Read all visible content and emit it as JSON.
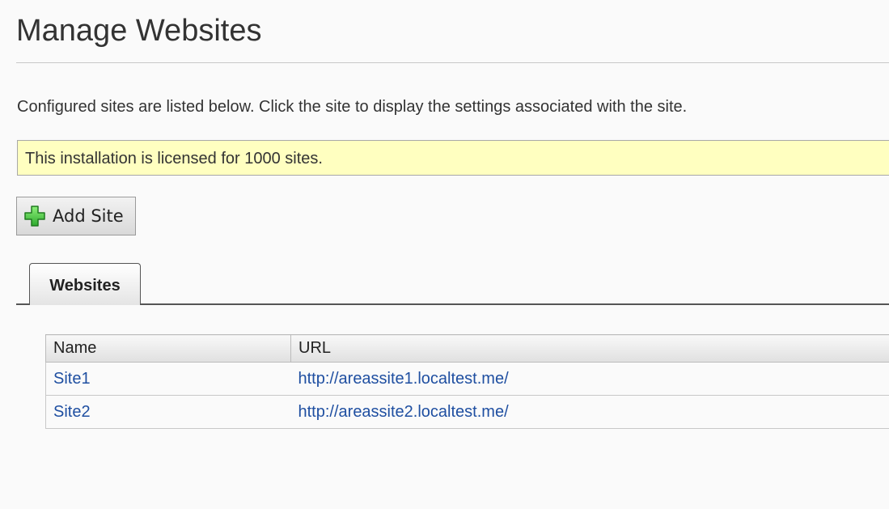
{
  "page": {
    "title": "Manage Websites",
    "intro": "Configured sites are listed below. Click the site to display the settings associated with the site."
  },
  "license_banner": {
    "text": "This installation is licensed for 1000 sites."
  },
  "toolbar": {
    "add_site_label": "Add Site",
    "add_site_icon": "plus-icon"
  },
  "tabs": [
    {
      "label": "Websites",
      "active": true
    }
  ],
  "table": {
    "columns": [
      "Name",
      "URL"
    ],
    "rows": [
      {
        "name": "Site1",
        "url": "http://areassite1.localtest.me/"
      },
      {
        "name": "Site2",
        "url": "http://areassite2.localtest.me/"
      }
    ]
  },
  "colors": {
    "link": "#1f4fa1",
    "banner_bg": "#ffffc0",
    "plus_icon": "#3cc43c"
  }
}
